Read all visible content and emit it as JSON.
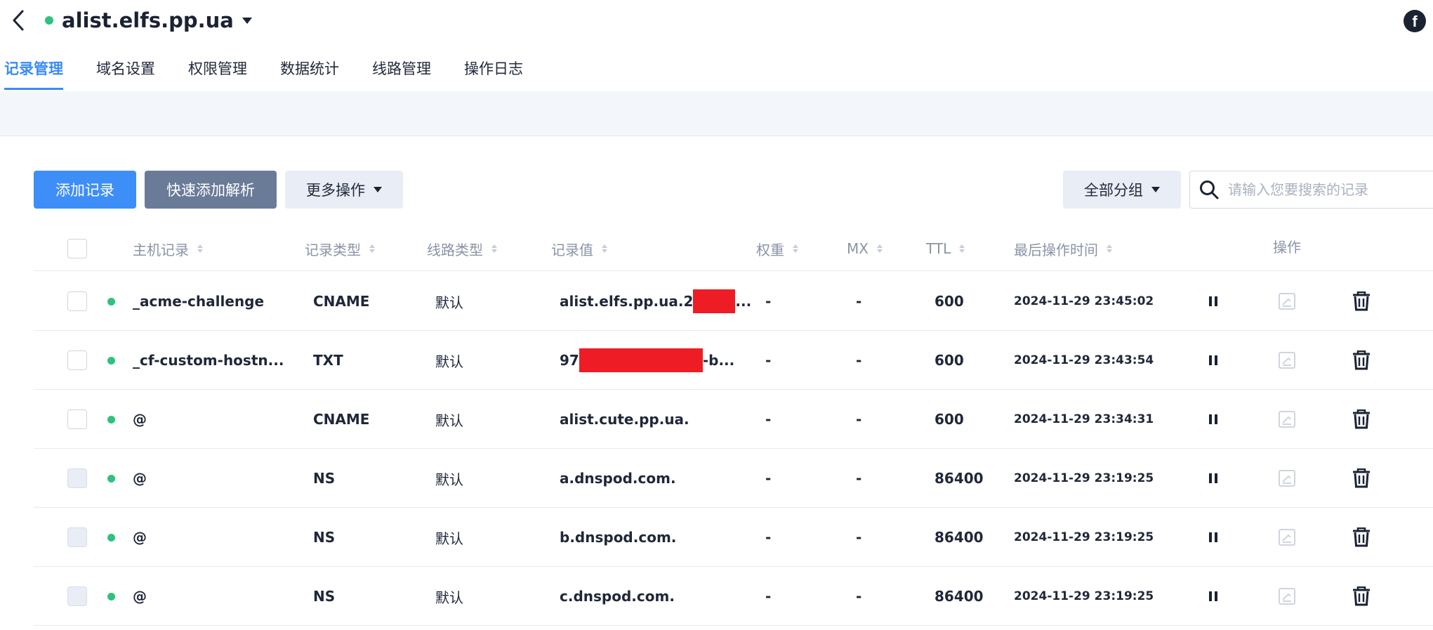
{
  "header": {
    "domain": "alist.elfs.pp.ua",
    "status_color": "#2ec27e",
    "back_icon": "chevron-left-icon",
    "right_icon": "facebook-icon",
    "right_icon_glyph": "f"
  },
  "tabs": [
    {
      "label": "记录管理",
      "active": true
    },
    {
      "label": "域名设置",
      "active": false
    },
    {
      "label": "权限管理",
      "active": false
    },
    {
      "label": "数据统计",
      "active": false
    },
    {
      "label": "线路管理",
      "active": false
    },
    {
      "label": "操作日志",
      "active": false
    }
  ],
  "toolbar": {
    "add_label": "添加记录",
    "quick_add_label": "快速添加解析",
    "more_label": "更多操作",
    "group_label": "全部分组",
    "search_placeholder": "请输入您要搜索的记录"
  },
  "table": {
    "columns": {
      "host": "主机记录",
      "type": "记录类型",
      "line": "线路类型",
      "value": "记录值",
      "weight": "权重",
      "mx": "MX",
      "ttl": "TTL",
      "updated": "最后操作时间",
      "actions": "操作"
    },
    "rows": [
      {
        "host": "_acme-challenge",
        "type": "CNAME",
        "line": "默认",
        "value_prefix": "alist.elfs.pp.ua.2",
        "value_suffix": "...",
        "redacted": true,
        "weight": "-",
        "mx": "-",
        "ttl": "600",
        "updated": "2024-11-29 23:45:02",
        "checkbox_disabled": false
      },
      {
        "host": "_cf-custom-hostn...",
        "type": "TXT",
        "line": "默认",
        "value_prefix": "97",
        "value_suffix": "-b...",
        "redacted": true,
        "weight": "-",
        "mx": "-",
        "ttl": "600",
        "updated": "2024-11-29 23:43:54",
        "checkbox_disabled": false
      },
      {
        "host": "@",
        "type": "CNAME",
        "line": "默认",
        "value_prefix": "alist.cute.pp.ua.",
        "value_suffix": "",
        "redacted": false,
        "weight": "-",
        "mx": "-",
        "ttl": "600",
        "updated": "2024-11-29 23:34:31",
        "checkbox_disabled": false
      },
      {
        "host": "@",
        "type": "NS",
        "line": "默认",
        "value_prefix": "a.dnspod.com.",
        "value_suffix": "",
        "redacted": false,
        "weight": "-",
        "mx": "-",
        "ttl": "86400",
        "updated": "2024-11-29 23:19:25",
        "checkbox_disabled": true
      },
      {
        "host": "@",
        "type": "NS",
        "line": "默认",
        "value_prefix": "b.dnspod.com.",
        "value_suffix": "",
        "redacted": false,
        "weight": "-",
        "mx": "-",
        "ttl": "86400",
        "updated": "2024-11-29 23:19:25",
        "checkbox_disabled": true
      },
      {
        "host": "@",
        "type": "NS",
        "line": "默认",
        "value_prefix": "c.dnspod.com.",
        "value_suffix": "",
        "redacted": false,
        "weight": "-",
        "mx": "-",
        "ttl": "86400",
        "updated": "2024-11-29 23:19:25",
        "checkbox_disabled": true
      }
    ],
    "row_icons": [
      "pause-icon",
      "edit-icon",
      "trash-icon"
    ]
  },
  "colors": {
    "accent": "#3b8bf5",
    "primary_button": "#3e8ef7",
    "secondary_button": "#6a7b98",
    "status_enabled": "#2ec27e",
    "redaction": "#ee1c25"
  }
}
